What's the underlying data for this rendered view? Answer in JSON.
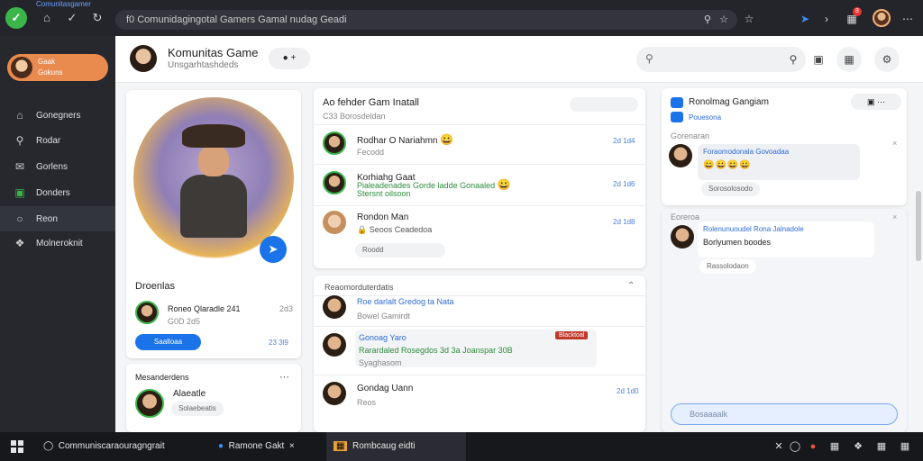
{
  "browser": {
    "tab_title": "Comunitasgamer",
    "url": "f0 Comunidagingotal Gamers Gamal nudag Geadi",
    "ext_badge": "8"
  },
  "sidebar": {
    "profile_name": "Gaak",
    "profile_sub": "Gokuns",
    "items": [
      {
        "icon": "home-icon",
        "label": "Gonegners"
      },
      {
        "icon": "search-icon",
        "label": "Rodar"
      },
      {
        "icon": "chat-icon",
        "label": "Gorlens"
      },
      {
        "icon": "groups-icon",
        "label": "Donders"
      },
      {
        "icon": "circle-icon",
        "label": "Reon"
      },
      {
        "icon": "gamepad-icon",
        "label": "Molneroknit"
      }
    ]
  },
  "header": {
    "title": "Komunitas Game",
    "subtitle": "Unsgarhtashdeds",
    "chip_label": "+"
  },
  "profile_card": {
    "section_title": "Droenlas",
    "friend_name": "Roneo Qlaradle 241",
    "friend_sub": "G0D 2d5",
    "friend_count": "2d3",
    "button_label": "Saalloaa",
    "button_count": "23 3l9"
  },
  "notifications_card": {
    "title": "Mesanderdens",
    "user_name": "Alaeatle",
    "user_sub": "Solaebeatis"
  },
  "feed_card": {
    "title": "Ao fehder Gam Inatall",
    "subtitle": "C33 Borosdeldan",
    "posts": [
      {
        "name": "Rodhar O Nariahmn",
        "sub": "Fecodd",
        "time": "2d 1d4",
        "emoji": "😀"
      },
      {
        "name": "Korhiahg Gaat",
        "sub": "Stersnt oilsoon",
        "text": "Pialeadenades Gorde ladde Gonaaled",
        "time": "2d 1d6",
        "emoji": "😀"
      },
      {
        "name": "Rondon Man",
        "sub": "Seoos Ceadedoa",
        "reply": "Roodd",
        "time": "2d 1d8",
        "emoji": "🔒"
      }
    ]
  },
  "mentions_card": {
    "title": "Reaomorduterdatis",
    "posts": [
      {
        "name": "Roe darlalt Gredog ta Nata",
        "sub": "Bowel Gamirdt"
      },
      {
        "name": "Gonoag Yaro",
        "sub": "Syaghasom",
        "text": "Rarardaled Rosegdos 3d 3a Joanspar 30B",
        "badge": "Blacktoal"
      },
      {
        "name": "Gondag Uann",
        "sub": "Reos",
        "time": "2d 1d0"
      }
    ]
  },
  "chat": {
    "title": "Ronolmag Gangiam",
    "tab": "Pouesona",
    "group1_title": "Gorenaran",
    "msg1": "Foraomodonala Govoadaa",
    "msg1_time": "Sorosolosodo",
    "group2_title": "Eoreroa",
    "msg2_title": "Rolenunuoudel Rona Jalnadole",
    "msg2_text": "Borlyumen boodes",
    "msg2_time": "Rassolodaon",
    "input_placeholder": "Bosaaaalk"
  },
  "taskbar": {
    "items": [
      {
        "label": "Communiscaraouragngrait",
        "icon": "search-icon"
      },
      {
        "label": "Ramone Gakt",
        "icon": "browser-icon"
      },
      {
        "label": "Rombcaug eidti",
        "icon": "app-icon"
      }
    ]
  },
  "colors": {
    "accent": "#1a73e8",
    "profile_pill": "#e98a4e",
    "online": "#3bb54a"
  }
}
